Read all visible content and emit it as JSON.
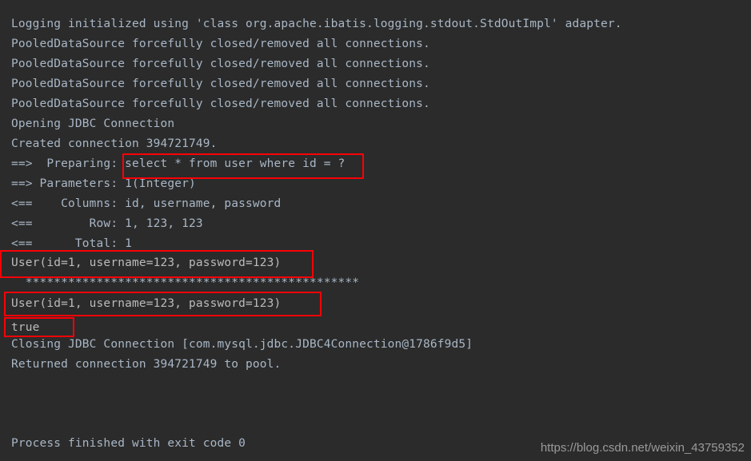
{
  "console": {
    "background_color": "#2b2b2b",
    "text_color": "#a9b7c6",
    "highlight_color": "#fb0007",
    "lines": [
      {
        "text": "Logging initialized using 'class org.apache.ibatis.logging.stdout.StdOutImpl' adapter."
      },
      {
        "text": "PooledDataSource forcefully closed/removed all connections."
      },
      {
        "text": "PooledDataSource forcefully closed/removed all connections."
      },
      {
        "text": "PooledDataSource forcefully closed/removed all connections."
      },
      {
        "text": "PooledDataSource forcefully closed/removed all connections."
      },
      {
        "text": "Opening JDBC Connection"
      },
      {
        "text": "Created connection 394721749."
      },
      {
        "text": "==>  Preparing: select * from user where id = ?"
      },
      {
        "text": "==> Parameters: 1(Integer)"
      },
      {
        "text": "<==    Columns: id, username, password"
      },
      {
        "text": "<==        Row: 1, 123, 123"
      },
      {
        "text": "<==      Total: 1"
      },
      {
        "text": "User(id=1, username=123, password=123)"
      },
      {
        "text": "  ***********************************************"
      },
      {
        "text": "User(id=1, username=123, password=123)"
      },
      {
        "text": "true"
      },
      {
        "text": "Closing JDBC Connection [com.mysql.jdbc.JDBC4Connection@1786f9d5]"
      },
      {
        "text": "Returned connection 394721749 to pool."
      }
    ],
    "exit_line": "Process finished with exit code 0",
    "highlights": [
      {
        "name": "prepared-sql-highlight",
        "label": "select * from user where id = ?"
      },
      {
        "name": "user-result-first-highlight",
        "label": "User(id=1, username=123, password=123)"
      },
      {
        "name": "user-result-second-highlight",
        "label": "User(id=1, username=123, password=123)"
      },
      {
        "name": "boolean-result-highlight",
        "label": "true"
      }
    ]
  },
  "watermark": {
    "text": "https://blog.csdn.net/weixin_43759352"
  }
}
